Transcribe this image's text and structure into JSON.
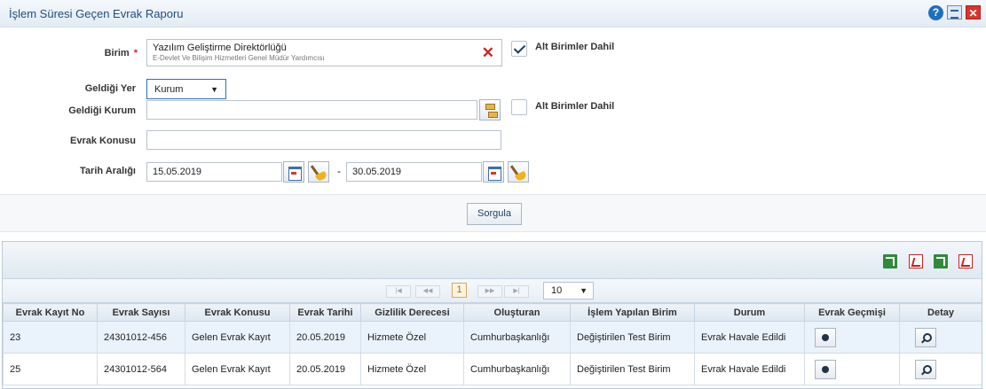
{
  "window": {
    "title": "İşlem Süresi Geçen Evrak Raporu"
  },
  "form": {
    "birim_label": "Birim",
    "birim_required": "*",
    "birim_value": "Yazılım Geliştirme Direktörlüğü",
    "birim_sub": "E-Devlet Ve Bilişim Hizmetleri Genel Müdür Yardımcısı",
    "birim_sub_checkbox": {
      "label": "Alt Birimler Dahil",
      "checked": true
    },
    "geldigi_yer_label": "Geldiği Yer",
    "geldigi_yer_value": "Kurum",
    "geldigi_kurum_label": "Geldiği Kurum",
    "geldigi_kurum_value": "",
    "kurum_sub_checkbox": {
      "label": "Alt Birimler Dahil",
      "checked": false
    },
    "evrak_konusu_label": "Evrak Konusu",
    "evrak_konusu_value": "",
    "tarih_label": "Tarih Aralığı",
    "tarih_start": "15.05.2019",
    "tarih_separator": "-",
    "tarih_end": "30.05.2019",
    "query_button": "Sorgula"
  },
  "pager": {
    "current_page": "1",
    "page_size": "10",
    "first": "|◀",
    "prev": "◀◀",
    "next": "▶▶",
    "last": "▶|"
  },
  "table": {
    "columns": [
      "Evrak Kayıt No",
      "Evrak Sayısı",
      "Evrak Konusu",
      "Evrak Tarihi",
      "Gizlilik Derecesi",
      "Oluşturan",
      "İşlem Yapılan Birim",
      "Durum",
      "Evrak Geçmişi",
      "Detay"
    ],
    "rows": [
      [
        "23",
        "24301012-456",
        "Gelen Evrak Kayıt",
        "20.05.2019",
        "Hizmete Özel",
        "Cumhurbaşkanlığı",
        "Değiştirilen Test Birim",
        "Evrak Havale Edildi"
      ],
      [
        "25",
        "24301012-564",
        "Gelen Evrak Kayıt",
        "20.05.2019",
        "Hizmete Özel",
        "Cumhurbaşkanlığı",
        "Değiştirilen Test Birim",
        "Evrak Havale Edildi"
      ]
    ]
  },
  "icons": {
    "help": "help-icon",
    "export_window": "window-export-icon",
    "close": "close-icon",
    "export": [
      "excel-export-icon",
      "pdf-export-icon",
      "excel-all-export-icon",
      "pdf-all-export-icon"
    ]
  }
}
